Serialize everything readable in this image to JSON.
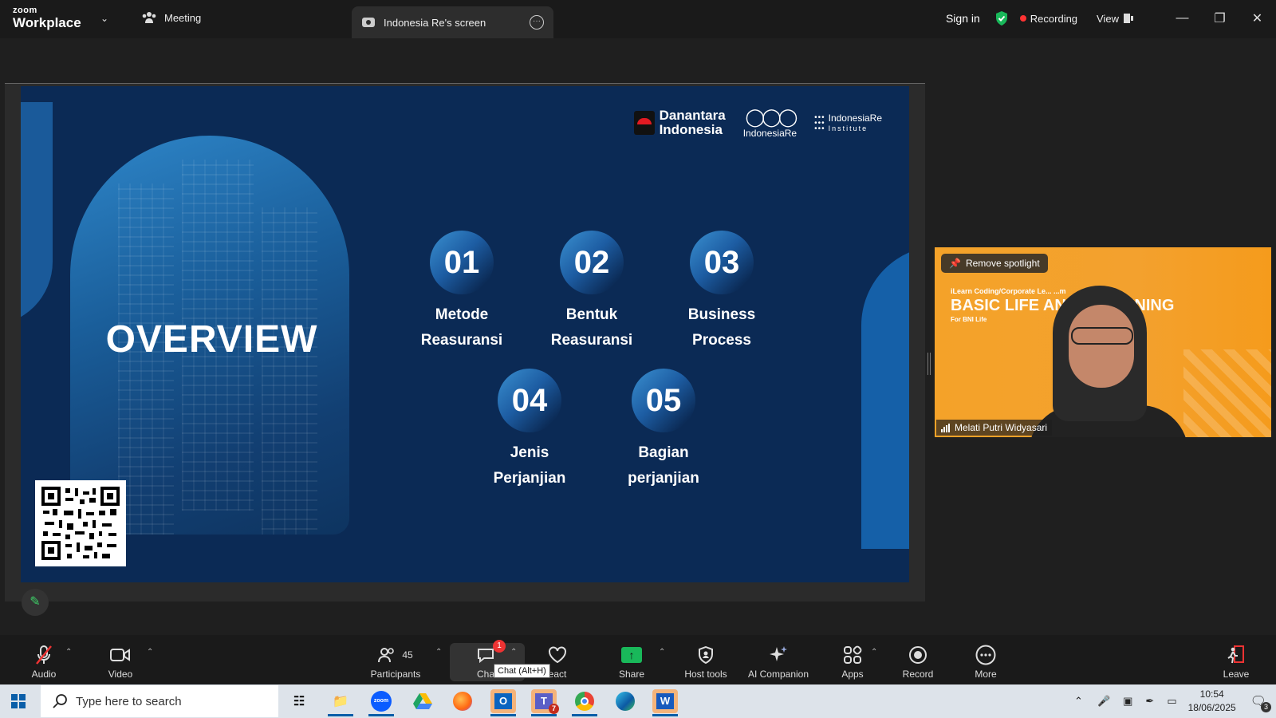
{
  "titlebar": {
    "brand_small": "zoom",
    "brand_large": "Workplace",
    "meeting_tab": "Meeting",
    "share_tab": "Indonesia Re's screen",
    "sign_in": "Sign in",
    "recording": "Recording",
    "view": "View"
  },
  "slide": {
    "title": "OVERVIEW",
    "logo_danantara_line1": "Danantara",
    "logo_danantara_line2": "Indonesia",
    "logo_indonesiare": "IndonesiaRe",
    "logo_institute_line1": "IndonesiaRe",
    "logo_institute_line2": "Institute",
    "items": [
      {
        "num": "01",
        "line1": "Metode",
        "line2": "Reasuransi"
      },
      {
        "num": "02",
        "line1": "Bentuk",
        "line2": "Reasuransi"
      },
      {
        "num": "03",
        "line1": "Business",
        "line2": "Process"
      },
      {
        "num": "04",
        "line1": "Jenis",
        "line2": "Perjanjian"
      },
      {
        "num": "05",
        "line1": "Bagian",
        "line2": "perjanjian"
      }
    ]
  },
  "spotlight": {
    "remove_label": "Remove spotlight",
    "participant_name": "Melati Putri Widyasari",
    "bg_top": "iLearn Coding/Corporate Le... ...m",
    "bg_title": "BASIC LIFE AN... ...TRAINING",
    "bg_sub": "For BNI Life"
  },
  "toolbar": {
    "audio": "Audio",
    "video": "Video",
    "participants": "Participants",
    "participants_count": "45",
    "chat": "Cha",
    "chat_badge": "1",
    "chat_tooltip": "Chat (Alt+H)",
    "react": "eact",
    "share": "Share",
    "host_tools": "Host tools",
    "ai_companion": "AI Companion",
    "apps": "Apps",
    "record": "Record",
    "more": "More",
    "leave": "Leave"
  },
  "taskbar": {
    "search_placeholder": "Type here to search",
    "time": "10:54",
    "date": "18/06/2025",
    "notif_count": "3",
    "teams_badge": "7"
  }
}
